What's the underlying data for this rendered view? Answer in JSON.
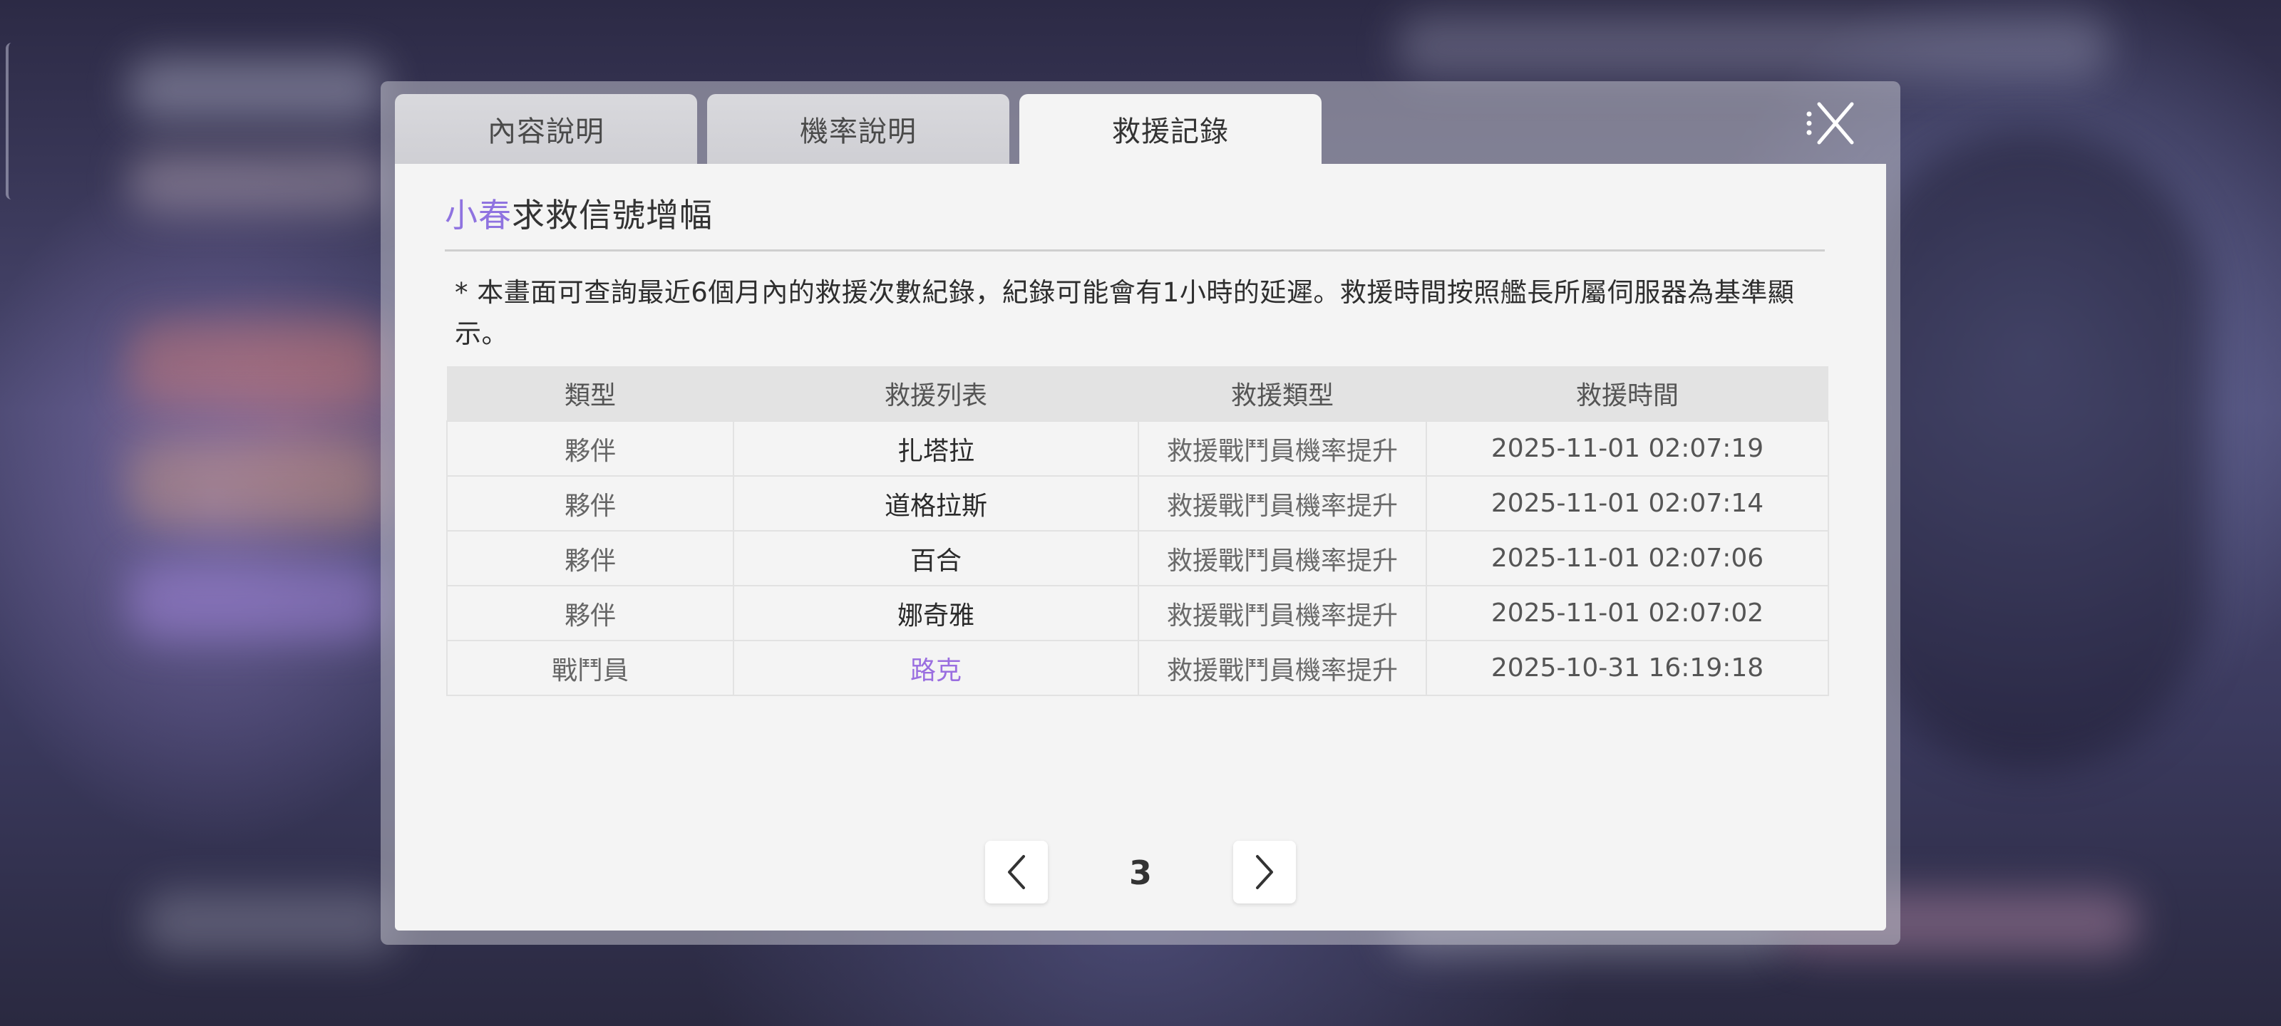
{
  "tabs": [
    {
      "label": "內容說明",
      "active": false
    },
    {
      "label": "機率說明",
      "active": false
    },
    {
      "label": "救援記錄",
      "active": true
    }
  ],
  "close": {
    "icon": "close-icon"
  },
  "title": {
    "highlight": "小春",
    "rest": "求救信號增幅",
    "highlight_color": "#8f73e0"
  },
  "notice": "* 本畫面可查詢最近6個月內的救援次數紀錄，紀錄可能會有1小時的延遲。救援時間按照艦長所屬伺服器為基準顯示。",
  "table": {
    "headers": [
      "類型",
      "救援列表",
      "救援類型",
      "救援時間"
    ],
    "rows": [
      {
        "type": "夥伴",
        "name": "扎塔拉",
        "kind": "救援戰鬥員機率提升",
        "time": "2025-11-01 02:07:19"
      },
      {
        "type": "夥伴",
        "name": "道格拉斯",
        "kind": "救援戰鬥員機率提升",
        "time": "2025-11-01 02:07:14"
      },
      {
        "type": "夥伴",
        "name": "百合",
        "kind": "救援戰鬥員機率提升",
        "time": "2025-11-01 02:07:06"
      },
      {
        "type": "夥伴",
        "name": "娜奇雅",
        "kind": "救援戰鬥員機率提升",
        "time": "2025-11-01 02:07:02"
      },
      {
        "type": "戰鬥員",
        "name": "路克",
        "kind": "救援戰鬥員機率提升",
        "time": "2025-10-31 16:19:18"
      }
    ],
    "highlight_name_color": "#9a6ee0"
  },
  "pagination": {
    "current_page": "3",
    "prev_icon": "chevron-left-icon",
    "next_icon": "chevron-right-icon"
  }
}
